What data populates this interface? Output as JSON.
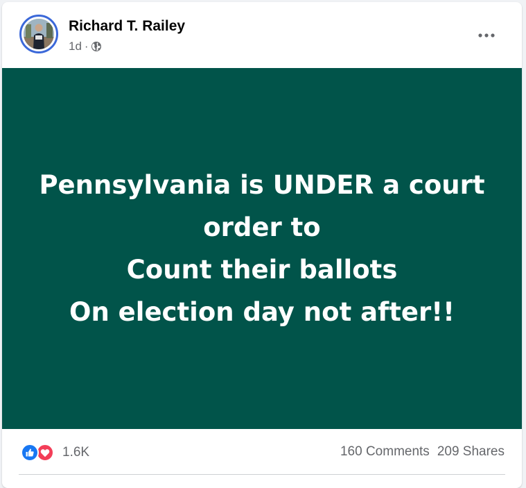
{
  "post": {
    "author": "Richard T. Railey",
    "time": "1d",
    "separator": "·",
    "audience_icon": "globe-icon",
    "more_icon": "more-options-icon",
    "image_background": "#01544a",
    "image_text_lines": [
      "Pennsylvania is UNDER a court",
      "order to",
      "Count their ballots",
      "On election day not after!!"
    ]
  },
  "engagement": {
    "reaction_icons": [
      "like-icon",
      "love-icon"
    ],
    "reaction_count": "1.6K",
    "comments": "160 Comments",
    "shares": "209 Shares"
  },
  "colors": {
    "like": "#1877f2",
    "love": "#f33e58",
    "avatar_ring": "#3b68d9",
    "secondary_text": "#65676b"
  }
}
